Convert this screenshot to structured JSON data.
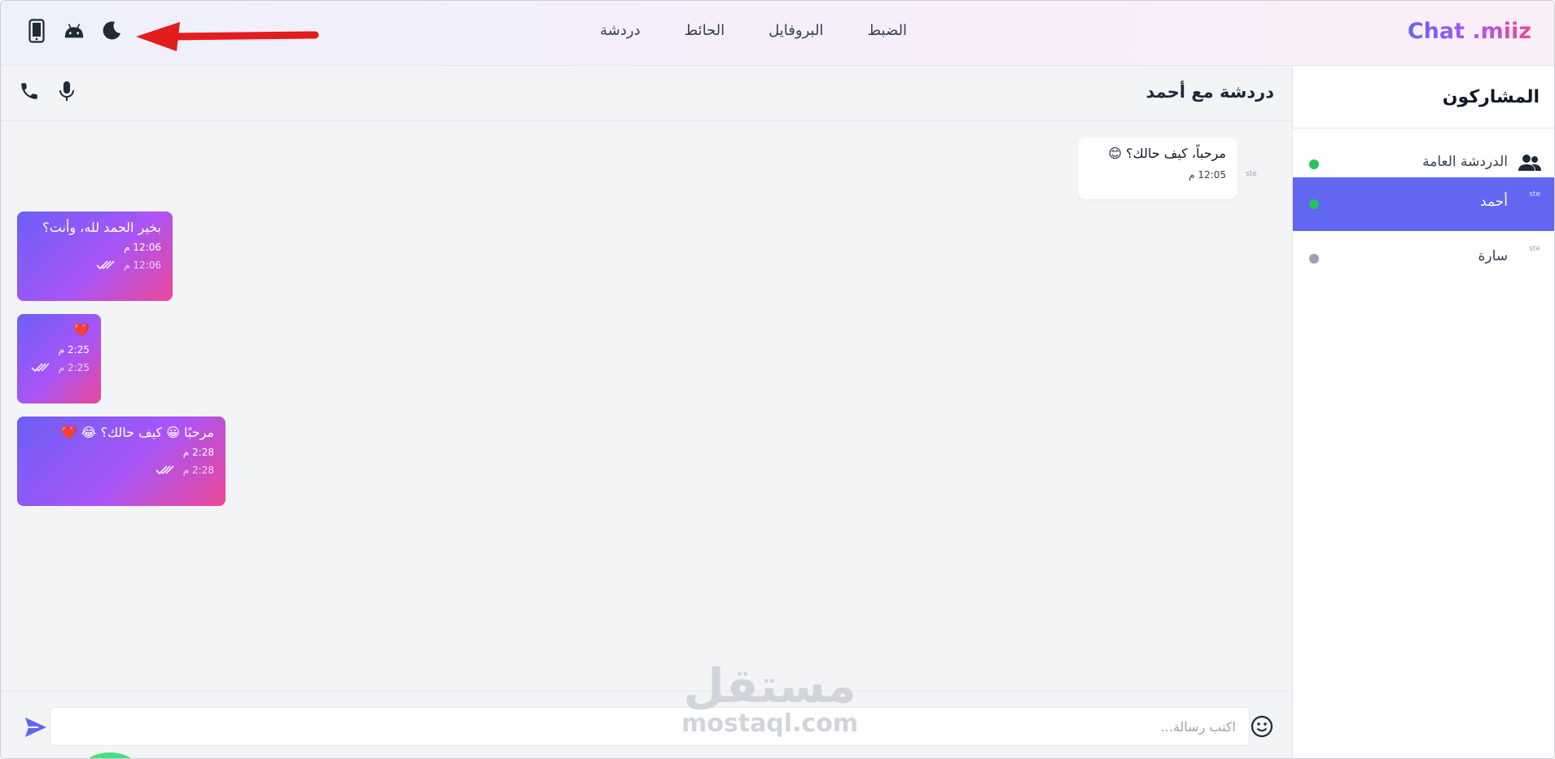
{
  "header": {
    "brand": "Chat .miiz",
    "nav": [
      "دردشة",
      "الحائط",
      "البروفايل",
      "الضبط"
    ],
    "icons": [
      "mobile-icon",
      "android-icon",
      "moon-icon"
    ]
  },
  "chat": {
    "title": "دردشة مع أحمد",
    "header_icons": [
      "phone-icon",
      "microphone-icon"
    ],
    "incoming": {
      "text": "مرحباً، كيف حالك؟ 😊",
      "time": "12:05 م",
      "avatar_alt": "ste"
    },
    "outgoing": [
      {
        "text": "بخير الحمد لله، وأنت؟",
        "time": "12:06 م",
        "meta_time": "12:06 م"
      },
      {
        "text": "❤️",
        "time": "2:25 م",
        "meta_time": "2:25 م"
      },
      {
        "text": "مرحبًا 😀 كيف حالك؟ 😂 ❤️",
        "time": "2:28 م",
        "meta_time": "2:28 م"
      }
    ],
    "input_placeholder": "اكتب رسالة..."
  },
  "sidebar": {
    "title": "المشاركون",
    "participants": [
      {
        "name": "الدردشة العامة",
        "status": "online",
        "type": "group"
      },
      {
        "name": "أحمد",
        "status": "online",
        "type": "user",
        "avatar_alt": "ste",
        "active": true
      },
      {
        "name": "سارة",
        "status": "offline",
        "type": "user",
        "avatar_alt": "ste"
      }
    ]
  },
  "watermark": {
    "ar": "مستقل",
    "en": "mostaql.com"
  },
  "colors": {
    "accent": "#6366f1",
    "online": "#22c55e",
    "offline": "#9ca3af",
    "bubble_gradient_start": "#6d5ff5",
    "bubble_gradient_end": "#ec4899"
  }
}
